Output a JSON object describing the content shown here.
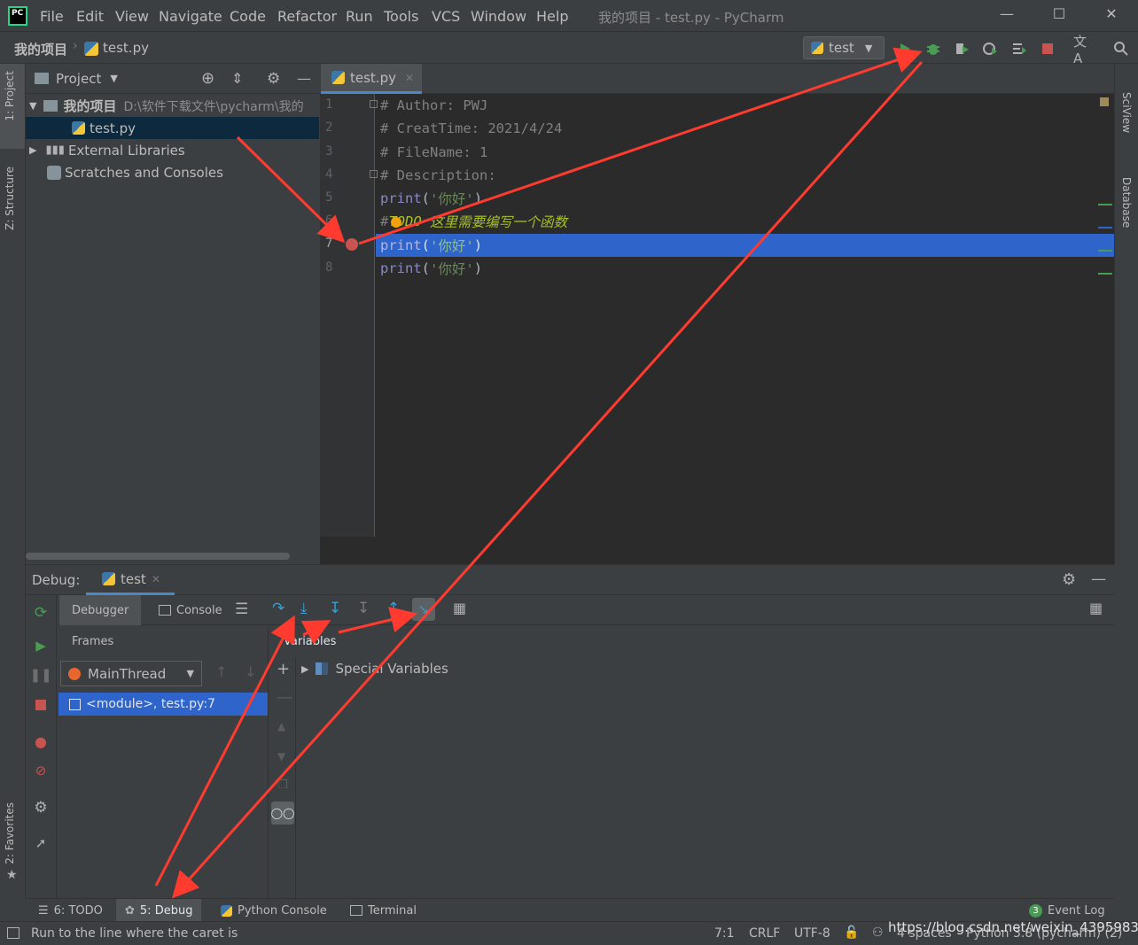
{
  "menubar": {
    "items": [
      "File",
      "Edit",
      "View",
      "Navigate",
      "Code",
      "Refactor",
      "Run",
      "Tools",
      "VCS",
      "Window",
      "Help"
    ],
    "title": "我的项目 - test.py - PyCharm"
  },
  "navbar": {
    "project": "我的项目",
    "file": "test.py",
    "run_config": "test"
  },
  "left_tool": {
    "project_tab": "1: Project",
    "structure_tab": "Z: Structure",
    "favorites_tab": "2: Favorites"
  },
  "right_tool": {
    "sciview_tab": "SciView",
    "database_tab": "Database"
  },
  "project": {
    "header": "Project",
    "root_name": "我的项目",
    "root_path": "D:\\软件下载文件\\pycharm\\我的",
    "file": "test.py",
    "external": "External Libraries",
    "scratches": "Scratches and Consoles"
  },
  "editor": {
    "tab": "test.py",
    "line_numbers": [
      "1",
      "2",
      "3",
      "4",
      "5",
      "6",
      "7",
      "8"
    ],
    "lines": {
      "l1": "# Author: PWJ",
      "l2": "# CreatTime: 2021/4/24",
      "l3": "# FileName: 1",
      "l4": "# Description:",
      "print_kw": "print",
      "paren_open": "(",
      "str_hello": "'你好'",
      "paren_close": ")",
      "l6_hash": "#",
      "l6_todo": "TODO",
      "l6_text": " 这里需要编写一个函数"
    },
    "current_line": 7,
    "breakpoint_line": 7
  },
  "debug": {
    "label": "Debug:",
    "tab": "test",
    "debugger_tab": "Debugger",
    "console_tab": "Console",
    "frames_label": "Frames",
    "variables_label": "Variables",
    "thread": "MainThread",
    "frame": "<module>, test.py:7",
    "special_vars": "Special Variables"
  },
  "bottom_tabs": {
    "todo": "6: TODO",
    "debug": "5: Debug",
    "python_console": "Python Console",
    "terminal": "Terminal",
    "event_log_count": "3",
    "event_log": "Event Log"
  },
  "status": {
    "message": "Run to the line where the caret is",
    "position": "7:1",
    "line_sep": "CRLF",
    "encoding": "UTF-8",
    "indent": "4 spaces",
    "interpreter": "Python 3.8 (pycharm) (2)",
    "watermark": "https://blog.csdn.net/weixin_43959833"
  },
  "colors": {
    "accent": "#4a88c7",
    "selection": "#2f65ca",
    "annotation_arrow": "#ff3b30",
    "run_green": "#499c54",
    "stop_red": "#c75450"
  }
}
